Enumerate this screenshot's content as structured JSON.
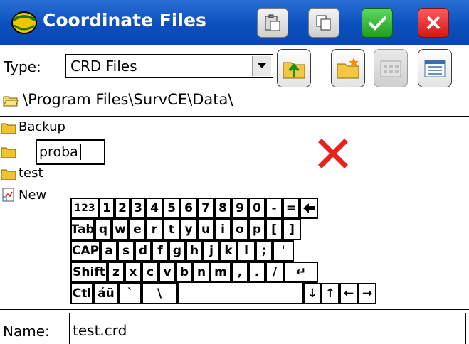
{
  "window": {
    "title": "Coordinate Files"
  },
  "toolbar": {
    "paste_icon": "paste-icon",
    "copy_icon": "copy-icon",
    "ok_icon": "checkmark-icon",
    "cancel_icon": "close-icon"
  },
  "filter": {
    "type_label": "Type:",
    "type_value": "CRD Files"
  },
  "path": {
    "current": "\\Program Files\\SurvCE\\Data\\"
  },
  "files": {
    "items": [
      {
        "label": "Backup",
        "icon": "folder-icon"
      },
      {
        "label": "proba",
        "icon": "folder-icon"
      },
      {
        "label": "test",
        "icon": "folder-icon"
      },
      {
        "label": "New",
        "icon": "shortcut-file-icon"
      }
    ],
    "rename_value": "proba"
  },
  "keyboard": {
    "row1": [
      "123",
      "1",
      "2",
      "3",
      "4",
      "5",
      "6",
      "7",
      "8",
      "9",
      "0",
      "-",
      "=",
      "◆"
    ],
    "row2": [
      "Tab",
      "q",
      "w",
      "e",
      "r",
      "t",
      "y",
      "u",
      "i",
      "o",
      "p",
      "[",
      "]"
    ],
    "row3": [
      "CAP",
      "a",
      "s",
      "d",
      "f",
      "g",
      "h",
      "j",
      "k",
      "l",
      ";",
      "'"
    ],
    "row4": [
      "Shift",
      "z",
      "x",
      "c",
      "v",
      "b",
      "n",
      "m",
      ",",
      ".",
      "/",
      "↵"
    ],
    "row5": [
      "Ctl",
      "áü",
      "`",
      "\\",
      "",
      "↓",
      "↑",
      "←",
      "→"
    ]
  },
  "footer": {
    "name_label": "Name:",
    "name_value": "test.crd"
  },
  "colors": {
    "titlebar": "#0b4fbf",
    "ok": "#1f9e1f",
    "cancel": "#d31717",
    "invalid_mark": "#e8211d"
  }
}
